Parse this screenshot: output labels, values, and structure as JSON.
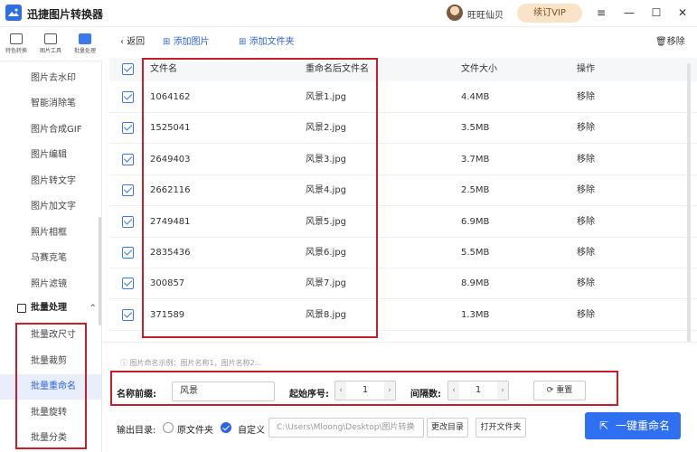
{
  "app": {
    "title": "迅捷图片转换器",
    "user_name": "旺旺仙贝",
    "vip_label": "续订VIP",
    "window_controls": [
      "≡",
      "—",
      "☐",
      "✕"
    ]
  },
  "toolnav": [
    {
      "label": "特色转换",
      "icon": "convert-icon"
    },
    {
      "label": "图片工具",
      "icon": "image-tool-icon"
    },
    {
      "label": "批量处理",
      "icon": "batch-icon",
      "active": true
    }
  ],
  "sidebar": {
    "items": [
      "图片去水印",
      "智能消除笔",
      "图片合成GIF",
      "图片编辑",
      "图片转文字",
      "图片加文字",
      "照片相框",
      "马赛克笔",
      "照片滤镜"
    ],
    "group_label": "批量处理",
    "batch_items": [
      "批量改尺寸",
      "批量裁剪",
      "批量重命名",
      "批量旋转",
      "批量分类"
    ],
    "active": "批量重命名"
  },
  "toolbar": {
    "back": "返回",
    "add_image": "添加图片",
    "add_folder": "添加文件夹",
    "remove": "移除"
  },
  "table": {
    "headers": [
      "文件名",
      "重命名后文件名",
      "文件大小",
      "操作"
    ],
    "rows": [
      {
        "name": "1064162",
        "new_name": "风景1.jpg",
        "size": "4.4MB",
        "action": "移除"
      },
      {
        "name": "1525041",
        "new_name": "风景2.jpg",
        "size": "3.5MB",
        "action": "移除"
      },
      {
        "name": "2649403",
        "new_name": "风景3.jpg",
        "size": "3.7MB",
        "action": "移除"
      },
      {
        "name": "2662116",
        "new_name": "风景4.jpg",
        "size": "2.5MB",
        "action": "移除"
      },
      {
        "name": "2749481",
        "new_name": "风景5.jpg",
        "size": "6.9MB",
        "action": "移除"
      },
      {
        "name": "2835436",
        "new_name": "风景6.jpg",
        "size": "5.5MB",
        "action": "移除"
      },
      {
        "name": "300857",
        "new_name": "风景7.jpg",
        "size": "8.9MB",
        "action": "移除"
      },
      {
        "name": "371589",
        "new_name": "风景8.jpg",
        "size": "1.3MB",
        "action": "移除"
      }
    ]
  },
  "settings": {
    "hint": "图片命名示例：图片名称1，图片名称2...",
    "prefix_label": "名称前缀:",
    "prefix_value": "风景",
    "start_label": "起始序号:",
    "start_value": "1",
    "interval_label": "间隔数:",
    "interval_value": "1",
    "reset_label": "重置",
    "output_label": "输出目录:",
    "original_folder": "原文件夹",
    "custom": "自定义",
    "path": "C:\\Users\\Mloong\\Desktop\\图片转换",
    "change_dir": "更改目录",
    "open_folder": "打开文件夹",
    "rename_button": "一键重命名"
  },
  "colors": {
    "accent": "#2f6ff2",
    "highlight_box": "#c81e2b"
  }
}
